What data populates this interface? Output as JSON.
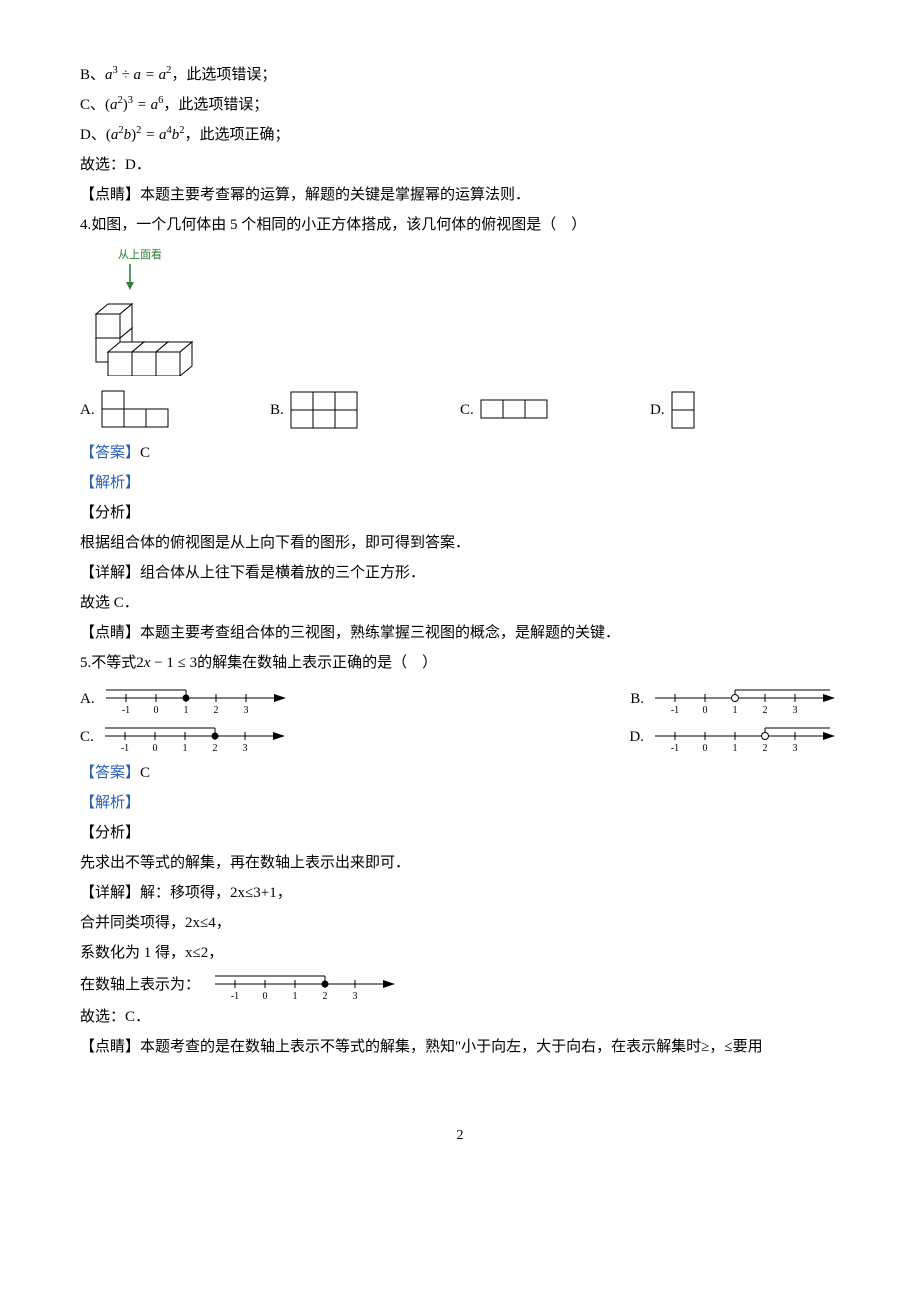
{
  "lines": {
    "b_label": "B、",
    "b_math_pre": "a",
    "b_math_sup1": "3",
    "b_math_mid": " ÷ a = a",
    "b_math_sup2": "2",
    "b_tail": "，此选项错误；",
    "c_label": "C、",
    "c_paren_open": "(",
    "c_inner_a": "a",
    "c_inner_sup": "2",
    "c_paren_close": ")",
    "c_outer_sup": "3",
    "c_eq": " = a",
    "c_rhs_sup": "6",
    "c_tail": "，此选项错误；",
    "d_label": "D、",
    "d_paren_open": "(",
    "d_inner_a": "a",
    "d_inner_sup1": "2",
    "d_inner_b": "b",
    "d_paren_close": ")",
    "d_outer_sup": "2",
    "d_eq": " = a",
    "d_rhs_sup1": "4",
    "d_rhs_b": "b",
    "d_rhs_sup2": "2",
    "d_tail": "，此选项正确；",
    "so_d": "故选：D．",
    "tip_power": "【点睛】本题主要考查幂的运算，解题的关键是掌握幂的运算法则．"
  },
  "q4": {
    "stem": "4.如图，一个几何体由 5 个相同的小正方体搭成，该几何体的俯视图是（　）",
    "fig_caption": "从上面看",
    "opts": {
      "a": "A.",
      "b": "B.",
      "c": "C.",
      "d": "D."
    },
    "answer_label": "【答案】",
    "answer_val": "C",
    "jiexi": "【解析】",
    "fenxi": "【分析】",
    "fenxi_body": "根据组合体的俯视图是从上向下看的图形，即可得到答案．",
    "detail": "【详解】组合体从上往下看是横着放的三个正方形．",
    "so": "故选 C．",
    "tip": "【点睛】本题主要考查组合体的三视图，熟练掌握三视图的概念，是解题的关键．"
  },
  "q5": {
    "stem_pre": "5.不等式",
    "stem_math1": "2",
    "stem_math_x": "x",
    "stem_math2": " − 1 ≤ 3",
    "stem_post": "的解集在数轴上表示正确的是（　）",
    "opts": {
      "a": "A.",
      "b": "B.",
      "c": "C.",
      "d": "D."
    },
    "answer_label": "【答案】",
    "answer_val": "C",
    "jiexi": "【解析】",
    "fenxi": "【分析】",
    "fenxi_body": "先求出不等式的解集，再在数轴上表示出来即可．",
    "detail1": "【详解】解：移项得，2x≤3+1，",
    "detail2": "合并同类项得，2x≤4，",
    "detail3": "系数化为 1 得，x≤2，",
    "detail4": "在数轴上表示为：",
    "so": "故选：C．",
    "tip": "【点睛】本题考查的是在数轴上表示不等式的解集，熟知\"小于向左，大于向右，在表示解集时≥，≤要用"
  },
  "page_num": "2"
}
